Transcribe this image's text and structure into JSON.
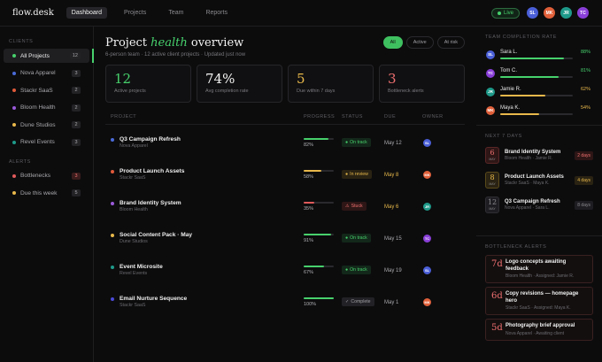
{
  "app": {
    "logo": "flow.desk"
  },
  "nav": [
    {
      "label": "Dashboard",
      "active": true
    },
    {
      "label": "Projects",
      "active": false
    },
    {
      "label": "Team",
      "active": false
    },
    {
      "label": "Reports",
      "active": false
    }
  ],
  "live_label": "Live",
  "header_avatars": [
    {
      "initials": "SL",
      "color": "#4a5fd8"
    },
    {
      "initials": "MK",
      "color": "#e0603a"
    },
    {
      "initials": "JR",
      "color": "#1f9a8a"
    },
    {
      "initials": "TC",
      "color": "#8a3fd8"
    }
  ],
  "sidebar": {
    "clients_heading": "CLIENTS",
    "clients": [
      {
        "label": "All Projects",
        "count": "12",
        "color": "#47d16c",
        "active": true
      },
      {
        "label": "Nova Apparel",
        "count": "3",
        "color": "#4a6ad8",
        "active": false
      },
      {
        "label": "Stackr SaaS",
        "count": "2",
        "color": "#e05a3a",
        "active": false
      },
      {
        "label": "Bloom Health",
        "count": "2",
        "color": "#9a5ad8",
        "active": false
      },
      {
        "label": "Dune Studios",
        "count": "2",
        "color": "#e8b84a",
        "active": false
      },
      {
        "label": "Revel Events",
        "count": "3",
        "color": "#1f9a8a",
        "active": false
      }
    ],
    "alerts_heading": "ALERTS",
    "alerts": [
      {
        "label": "Bottlenecks",
        "count": "3",
        "color": "#e05a5a",
        "alert": true
      },
      {
        "label": "Due this week",
        "count": "5",
        "color": "#e8b84a",
        "alert": false
      }
    ]
  },
  "main": {
    "title_before": "Project ",
    "title_em": "health",
    "title_after": " overview",
    "subtitle": "6-person team · 12 active client projects · Updated just now",
    "filters": [
      {
        "label": "All",
        "active": true
      },
      {
        "label": "Active",
        "active": false
      },
      {
        "label": "At risk",
        "active": false
      }
    ],
    "stats": [
      {
        "value": "12",
        "label": "Active projects",
        "color": "#47d16c"
      },
      {
        "value": "74%",
        "label": "Avg completion rate",
        "color": "#f3f3f3"
      },
      {
        "value": "5",
        "label": "Due within 7 days",
        "color": "#e8b84a"
      },
      {
        "value": "3",
        "label": "Bottleneck alerts",
        "color": "#f07070"
      }
    ],
    "columns": {
      "project": "PROJECT",
      "progress": "PROGRESS",
      "status": "STATUS",
      "due": "DUE",
      "owner": "OWNER"
    },
    "rows": [
      {
        "name": "Q3 Campaign Refresh",
        "client": "Nova Apparel",
        "dot": "#4a6ad8",
        "progress": 82,
        "progress_label": "82%",
        "bar": "#47d16c",
        "status": "On track",
        "status_icon": "●",
        "status_fg": "#47d16c",
        "status_bg": "#13281a",
        "due": "May 12",
        "due_warn": false,
        "owner": "SL",
        "owner_color": "#4a5fd8"
      },
      {
        "name": "Product Launch Assets",
        "client": "Stackr SaaS",
        "dot": "#e05a3a",
        "progress": 58,
        "progress_label": "58%",
        "bar": "#e8b84a",
        "status": "In review",
        "status_icon": "●",
        "status_fg": "#e8b84a",
        "status_bg": "#2a2313",
        "due": "May 8",
        "due_warn": true,
        "owner": "MK",
        "owner_color": "#e0603a"
      },
      {
        "name": "Brand Identity System",
        "client": "Bloom Health",
        "dot": "#9a5ad8",
        "progress": 35,
        "progress_label": "35%",
        "bar": "#e05a5a",
        "status": "Stuck",
        "status_icon": "⚠",
        "status_fg": "#f07070",
        "status_bg": "#2e1616",
        "due": "May 6",
        "due_warn": true,
        "owner": "JR",
        "owner_color": "#1f9a8a"
      },
      {
        "name": "Social Content Pack · May",
        "client": "Dune Studios",
        "dot": "#e8b84a",
        "progress": 91,
        "progress_label": "91%",
        "bar": "#47d16c",
        "status": "On track",
        "status_icon": "●",
        "status_fg": "#47d16c",
        "status_bg": "#13281a",
        "due": "May 15",
        "due_warn": false,
        "owner": "TC",
        "owner_color": "#8a3fd8"
      },
      {
        "name": "Event Microsite",
        "client": "Revel Events",
        "dot": "#1f9a8a",
        "progress": 67,
        "progress_label": "67%",
        "bar": "#47d16c",
        "status": "On track",
        "status_icon": "●",
        "status_fg": "#47d16c",
        "status_bg": "#13281a",
        "due": "May 19",
        "due_warn": false,
        "owner": "SL",
        "owner_color": "#4a5fd8"
      },
      {
        "name": "Email Nurture Sequence",
        "client": "Stackr SaaS",
        "dot": "#4a4ad8",
        "progress": 100,
        "progress_label": "100%",
        "bar": "#47d16c",
        "status": "Complete",
        "status_icon": "✓",
        "status_fg": "#a0a0a4",
        "status_bg": "#222226",
        "due": "May 1",
        "due_warn": false,
        "owner": "MK",
        "owner_color": "#e0603a"
      }
    ]
  },
  "right": {
    "team_heading": "TEAM COMPLETION RATE",
    "team": [
      {
        "name": "Sara L.",
        "initials": "SL",
        "color": "#4a5fd8",
        "pct": 88,
        "pct_label": "88%",
        "bar": "#47d16c"
      },
      {
        "name": "Tom C.",
        "initials": "TC",
        "color": "#8a3fd8",
        "pct": 81,
        "pct_label": "81%",
        "bar": "#47d16c"
      },
      {
        "name": "Jamie R.",
        "initials": "JR",
        "color": "#1f9a8a",
        "pct": 62,
        "pct_label": "62%",
        "bar": "#e8b84a"
      },
      {
        "name": "Maya K.",
        "initials": "MK",
        "color": "#e0603a",
        "pct": 54,
        "pct_label": "54%",
        "bar": "#e8b84a"
      }
    ],
    "deadlines_heading": "NEXT 7 DAYS",
    "deadlines": [
      {
        "day": "6",
        "month": "MAY",
        "name": "Brand Identity System",
        "sub": "Bloom Health · Jamie R.",
        "badge": "2 days",
        "fg": "#f07070",
        "bg": "#2e1616",
        "border": "#5a2626"
      },
      {
        "day": "8",
        "month": "MAY",
        "name": "Product Launch Assets",
        "sub": "Stackr SaaS · Maya K.",
        "badge": "4 days",
        "fg": "#e8b84a",
        "bg": "#2a2313",
        "border": "#5a4a1a"
      },
      {
        "day": "12",
        "month": "MAY",
        "name": "Q3 Campaign Refresh",
        "sub": "Nova Apparel · Sara L.",
        "badge": "8 days",
        "fg": "#8a8a8e",
        "bg": "#1e1e22",
        "border": "#2e2e32"
      }
    ],
    "bottleneck_heading": "BOTTLENECK ALERTS",
    "bottlenecks": [
      {
        "days": "7d",
        "title": "Logo concepts awaiting feedback",
        "sub": "Bloom Health · Assigned: Jamie R."
      },
      {
        "days": "6d",
        "title": "Copy revisions — homepage hero",
        "sub": "Stackr SaaS · Assigned: Maya K."
      },
      {
        "days": "5d",
        "title": "Photography brief approval",
        "sub": "Nova Apparel · Awaiting client"
      }
    ]
  }
}
